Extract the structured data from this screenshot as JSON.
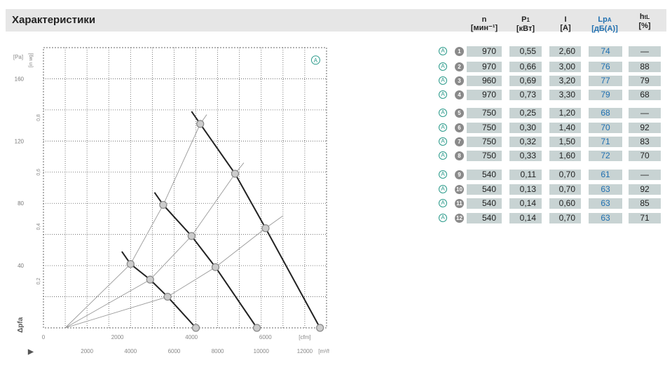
{
  "header": {
    "title": "Характеристики"
  },
  "columns": {
    "n": {
      "label": "n",
      "unit": "[мин⁻¹]"
    },
    "p1": {
      "label": "P",
      "sub": "1",
      "unit": "[кВт]"
    },
    "i": {
      "label": "I",
      "unit": "[A]"
    },
    "lpa": {
      "label": "Lp",
      "sub": "A",
      "unit": "[дБ(A)]"
    },
    "htl": {
      "label": "h",
      "sub": "tL",
      "unit": "[%]"
    }
  },
  "rows": [
    {
      "id": "1",
      "n": "970",
      "p1": "0,55",
      "i": "2,60",
      "lpa": "74",
      "htl": "—"
    },
    {
      "id": "2",
      "n": "970",
      "p1": "0,66",
      "i": "3,00",
      "lpa": "76",
      "htl": "88"
    },
    {
      "id": "3",
      "n": "960",
      "p1": "0,69",
      "i": "3,20",
      "lpa": "77",
      "htl": "79"
    },
    {
      "id": "4",
      "n": "970",
      "p1": "0,73",
      "i": "3,30",
      "lpa": "79",
      "htl": "68"
    },
    {
      "id": "5",
      "n": "750",
      "p1": "0,25",
      "i": "1,20",
      "lpa": "68",
      "htl": "—"
    },
    {
      "id": "6",
      "n": "750",
      "p1": "0,30",
      "i": "1,40",
      "lpa": "70",
      "htl": "92"
    },
    {
      "id": "7",
      "n": "750",
      "p1": "0,32",
      "i": "1,50",
      "lpa": "71",
      "htl": "83"
    },
    {
      "id": "8",
      "n": "750",
      "p1": "0,33",
      "i": "1,60",
      "lpa": "72",
      "htl": "70"
    },
    {
      "id": "9",
      "n": "540",
      "p1": "0,11",
      "i": "0,70",
      "lpa": "61",
      "htl": "—"
    },
    {
      "id": "10",
      "n": "540",
      "p1": "0,13",
      "i": "0,70",
      "lpa": "63",
      "htl": "92"
    },
    {
      "id": "11",
      "n": "540",
      "p1": "0,14",
      "i": "0,60",
      "lpa": "63",
      "htl": "85"
    },
    {
      "id": "12",
      "n": "540",
      "p1": "0,14",
      "i": "0,70",
      "lpa": "63",
      "htl": "71"
    }
  ],
  "row_marker": "A",
  "chart_data": {
    "type": "line",
    "title": "",
    "xlabel": "",
    "ylabel": "Δpfa",
    "x_units": [
      "[cfm]",
      "[m³/h]"
    ],
    "y_units": [
      "[in wg]",
      "[Pa]"
    ],
    "badge": "A",
    "xlim": [
      0,
      13000
    ],
    "ylim": [
      0,
      180
    ],
    "x_ticks": [
      0,
      2000,
      4000,
      6000,
      8000,
      10000,
      12000
    ],
    "y_ticks": [
      40,
      80,
      120,
      160
    ],
    "cfm_ticks": [
      0,
      2000,
      4000,
      6000
    ],
    "inwg_ticks": [
      "0,2",
      "0,4",
      "0,6",
      "0,8"
    ],
    "grid": true,
    "series": [
      {
        "speed": "970",
        "points": [
          [
            7200,
            131
          ],
          [
            8800,
            99
          ],
          [
            10200,
            64
          ],
          [
            12700,
            0
          ]
        ]
      },
      {
        "speed": "750",
        "points": [
          [
            5500,
            79
          ],
          [
            6800,
            59
          ],
          [
            7900,
            39
          ],
          [
            9800,
            0
          ]
        ]
      },
      {
        "speed": "540",
        "points": [
          [
            4000,
            41
          ],
          [
            4900,
            31
          ],
          [
            5700,
            20
          ],
          [
            7000,
            0
          ]
        ]
      }
    ],
    "system_curves": [
      {
        "points": [
          [
            1000,
            0
          ],
          [
            4000,
            41
          ],
          [
            5500,
            79
          ],
          [
            7200,
            131
          ],
          [
            7500,
            137
          ]
        ]
      },
      {
        "points": [
          [
            1000,
            0
          ],
          [
            4900,
            31
          ],
          [
            6800,
            59
          ],
          [
            8800,
            99
          ],
          [
            9200,
            106
          ]
        ]
      },
      {
        "points": [
          [
            1000,
            0
          ],
          [
            5700,
            20
          ],
          [
            7900,
            39
          ],
          [
            10200,
            64
          ],
          [
            11000,
            72
          ]
        ]
      }
    ]
  }
}
